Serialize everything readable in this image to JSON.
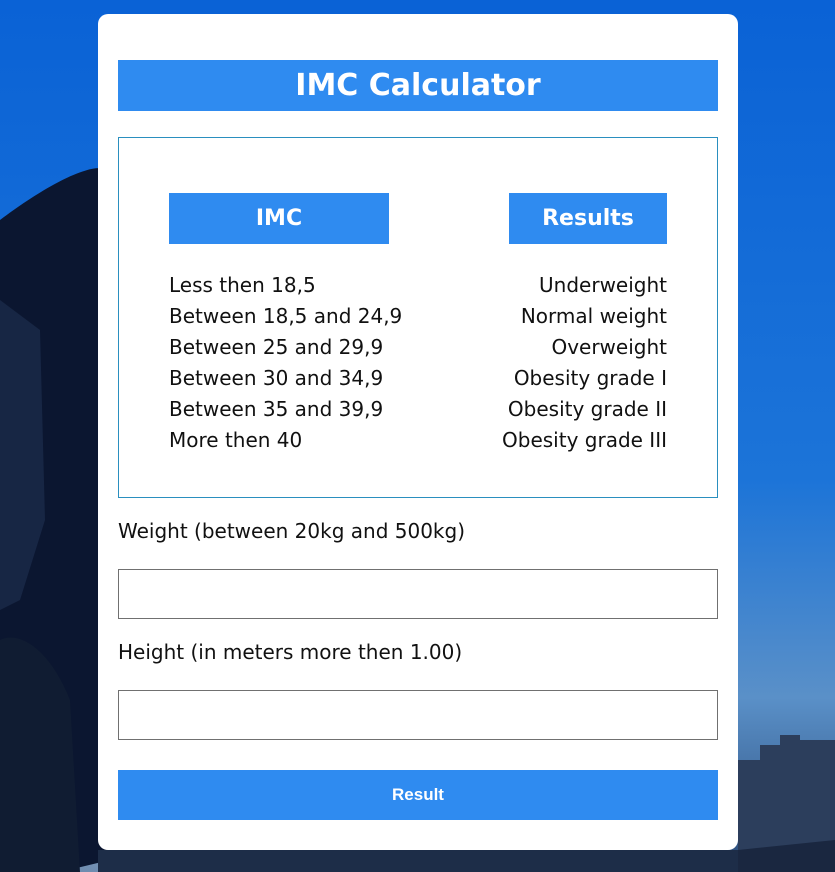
{
  "page": {
    "title": "IMC Calculator"
  },
  "table": {
    "imc_header": "IMC",
    "results_header": "Results",
    "rows": [
      {
        "range": "Less then 18,5",
        "result": "Underweight"
      },
      {
        "range": "Between 18,5 and 24,9",
        "result": "Normal weight"
      },
      {
        "range": "Between 25 and 29,9",
        "result": "Overweight"
      },
      {
        "range": "Between 30 and 34,9",
        "result": "Obesity grade I"
      },
      {
        "range": "Between 35 and 39,9",
        "result": "Obesity grade II"
      },
      {
        "range": "More then 40",
        "result": "Obesity grade III"
      }
    ]
  },
  "form": {
    "weight_label": "Weight (between 20kg and 500kg)",
    "weight_value": "",
    "weight_placeholder": "",
    "height_label": "Height (in meters more then 1.00)",
    "height_value": "",
    "height_placeholder": "",
    "submit_label": "Result"
  },
  "colors": {
    "accent": "#2f8bf0",
    "table_border": "#2a8fbf",
    "background": "#1565c8"
  }
}
